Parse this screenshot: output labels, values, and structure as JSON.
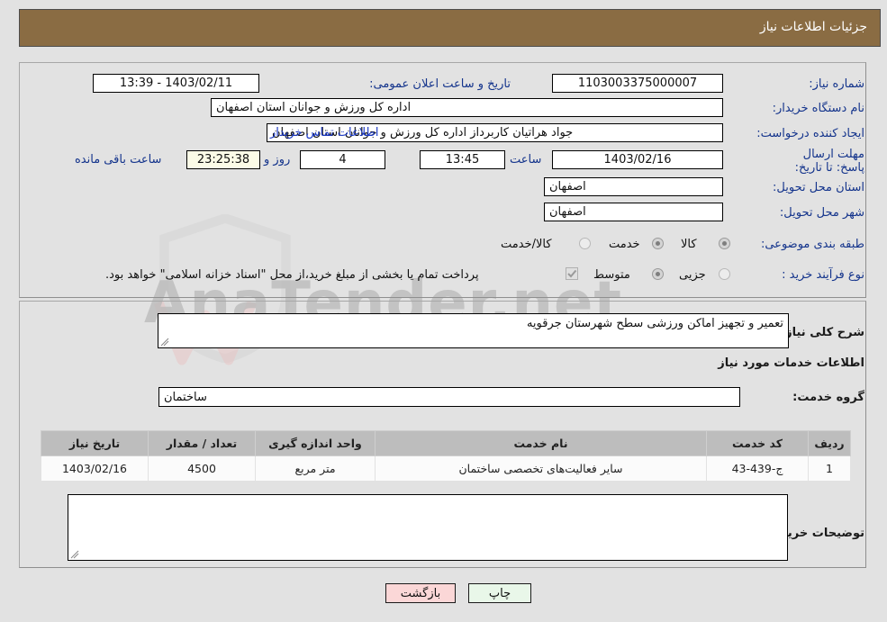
{
  "header": {
    "title": "جزئیات اطلاعات نیاز"
  },
  "form": {
    "need_number_label": "شماره نیاز:",
    "need_number_value": "1103003375000007",
    "announce_datetime_label": "تاریخ و ساعت اعلان عمومی:",
    "announce_datetime_value": "1403/02/11 - 13:39",
    "buyer_org_label": "نام دستگاه خریدار:",
    "buyer_org_value": "اداره کل ورزش و جوانان استان اصفهان",
    "creator_label": "ایجاد کننده درخواست:",
    "creator_value": "جواد هراتیان کاربرداز اداره کل ورزش و جوانان استان اصفهان",
    "contact_link": "اطلاعات تماس خریدار",
    "deadline_label": "مهلت ارسال پاسخ: تا تاریخ:",
    "deadline_date": "1403/02/16",
    "deadline_hour_label": "ساعت",
    "deadline_hour": "13:45",
    "remaining_days": "4",
    "remaining_days_label": "روز و",
    "remaining_time": "23:25:38",
    "remaining_time_label": "ساعت باقی مانده",
    "province_label": "استان محل تحویل:",
    "province_value": "اصفهان",
    "city_label": "شهر محل تحویل:",
    "city_value": "اصفهان",
    "category_label": "طبقه بندی موضوعی:",
    "category_options": [
      {
        "label": "کالا",
        "selected": false
      },
      {
        "label": "خدمت",
        "selected": true
      },
      {
        "label": "کالا/خدمت",
        "selected": false
      }
    ],
    "process_label": "نوع فرآیند خرید :",
    "process_options": [
      {
        "label": "جزیی",
        "selected": false
      },
      {
        "label": "متوسط",
        "selected": true
      }
    ],
    "treasury_checkbox_checked": true,
    "treasury_note": "پرداخت تمام یا بخشی از مبلغ خرید،از محل \"اسناد خزانه اسلامی\" خواهد بود."
  },
  "details": {
    "general_desc_label": "شرح کلی نیاز:",
    "general_desc_value": "تعمیر و تجهیز اماکن ورزشی سطح شهرستان جرقویه",
    "services_section_title": "اطلاعات خدمات مورد نیاز",
    "service_group_label": "گروه خدمت:",
    "service_group_value": "ساختمان",
    "buyer_notes_label": "توضیحات خریدار:",
    "buyer_notes_value": ""
  },
  "table": {
    "columns": [
      "ردیف",
      "کد خدمت",
      "نام خدمت",
      "واحد اندازه گیری",
      "تعداد / مقدار",
      "تاریخ نیاز"
    ],
    "rows": [
      {
        "row": "1",
        "code": "ج-439-43",
        "name": "سایر فعالیت‌های تخصصی ساختمان",
        "unit": "متر مربع",
        "quantity": "4500",
        "need_date": "1403/02/16"
      }
    ]
  },
  "buttons": {
    "print": "چاپ",
    "back": "بازگشت"
  },
  "watermark": {
    "text": "AnaTender.net"
  },
  "colors": {
    "header_bg": "#8a6c43",
    "link": "#1a38c4",
    "label": "#14348c",
    "page_bg": "#e2e2e2",
    "table_header_bg": "#bdbdbd",
    "print_btn_bg": "#e9f7e9",
    "back_btn_bg": "#fbd7d7"
  }
}
